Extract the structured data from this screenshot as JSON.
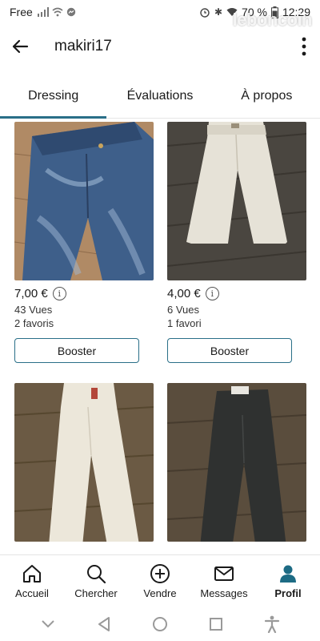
{
  "status_bar": {
    "carrier": "Free",
    "battery": "70 %",
    "time": "12:29",
    "watermark": "leboncoin"
  },
  "header": {
    "title": "makiri17",
    "back_icon": "arrow-left-icon",
    "menu_icon": "more-vertical-icon"
  },
  "tabs": [
    {
      "label": "Dressing",
      "active": true
    },
    {
      "label": "Évaluations",
      "active": false
    },
    {
      "label": "À propos",
      "active": false
    }
  ],
  "listings": [
    {
      "price": "7,00 €",
      "views": "43 Vues",
      "favorites": "2 favoris",
      "button": "Booster",
      "photo": "blue-jeans"
    },
    {
      "price": "4,00 €",
      "views": "6 Vues",
      "favorites": "1 favori",
      "button": "Booster",
      "photo": "white-trousers"
    },
    {
      "photo": "cream-trousers"
    },
    {
      "photo": "dark-grey-trousers"
    }
  ],
  "bottom_nav": [
    {
      "label": "Accueil",
      "icon": "home-icon",
      "active": false
    },
    {
      "label": "Chercher",
      "icon": "search-icon",
      "active": false
    },
    {
      "label": "Vendre",
      "icon": "plus-circle-icon",
      "active": false
    },
    {
      "label": "Messages",
      "icon": "mail-icon",
      "active": false
    },
    {
      "label": "Profil",
      "icon": "profile-icon",
      "active": true
    }
  ],
  "colors": {
    "accent": "#2a6f88",
    "profile_active": "#1d6b84"
  }
}
